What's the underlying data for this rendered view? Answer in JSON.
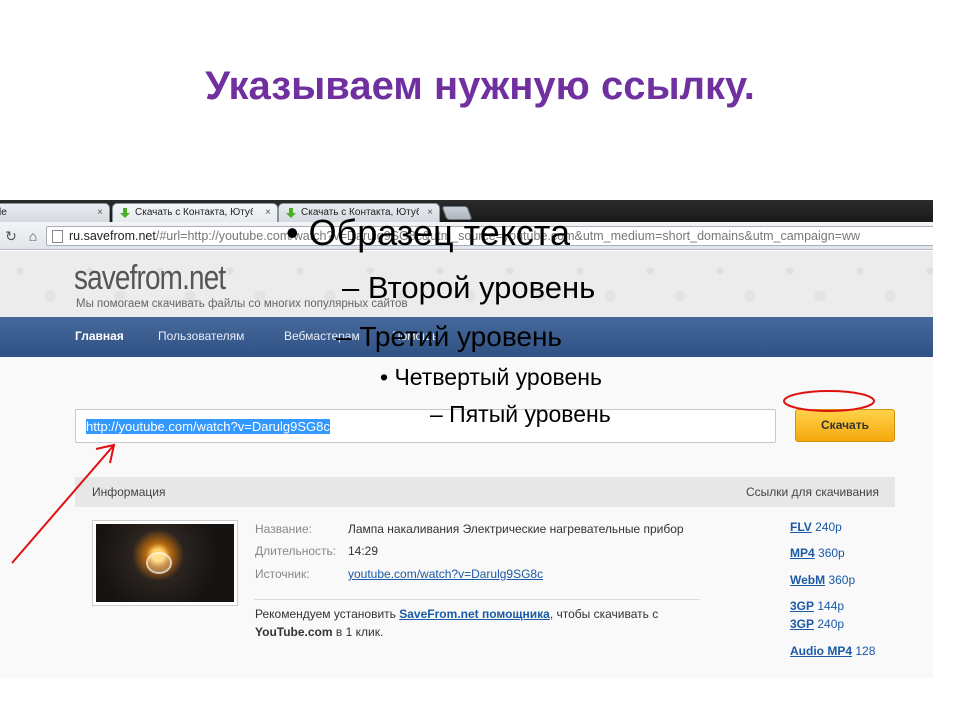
{
  "slide": {
    "title": "Указываем нужную ссылку."
  },
  "browser": {
    "tabs": [
      {
        "label": "le",
        "close": "×"
      },
      {
        "label": "Скачать с Контакта, Ютуб",
        "close": "×"
      },
      {
        "label": "Скачать с Контакта, Ютуб",
        "close": "×"
      }
    ],
    "address": {
      "host": "ru.savefrom.net",
      "rest": "/#url=http://youtube.com/watch?v=Darulg9SG8c&utm_source=youtube.com&utm_medium=short_domains&utm_campaign=ww"
    }
  },
  "site": {
    "logo": "savefrom.net",
    "tagline": "Мы помогаем скачивать файлы со многих популярных сайтов",
    "nav": [
      "Главная",
      "Пользователям",
      "Вебмастерам",
      "Помощь"
    ],
    "input_value": "http://youtube.com/watch?v=Darulg9SG8c",
    "download_button": "Скачать",
    "info_header": "Информация",
    "links_header": "Ссылки для скачивания",
    "meta": {
      "name_label": "Название:",
      "name_value": "Лампа накаливания Электрические нагревательные прибор",
      "duration_label": "Длительность:",
      "duration_value": "14:29",
      "source_label": "Источник:",
      "source_value": "youtube.com/watch?v=Darulg9SG8c"
    },
    "recommend": {
      "pre": "Рекомендуем установить ",
      "link": "SaveFrom.net помощника",
      "mid": ", чтобы скачивать с ",
      "bold": "YouTube.com",
      "post": " в 1 клик."
    },
    "download_links": [
      {
        "format": "FLV",
        "quality": "240p"
      },
      {
        "format": "MP4",
        "quality": "360p"
      },
      {
        "format": "WebM",
        "quality": "360p"
      },
      {
        "format": "3GP",
        "quality": "144p"
      },
      {
        "format": "3GP",
        "quality": "240p"
      },
      {
        "format": "Audio MP4",
        "quality": "128"
      }
    ]
  },
  "overlay": {
    "level1": "• Образец текста",
    "level2": "– Второй уровень",
    "level3": "– Третий уровень",
    "level4": "• Четвертый уровень",
    "level5": "– Пятый уровень"
  },
  "colors": {
    "title": "#7030a0",
    "annotation": "#e01010",
    "nav": "#2f5184",
    "button": "#f5a80c",
    "link": "#1a5aa6"
  }
}
